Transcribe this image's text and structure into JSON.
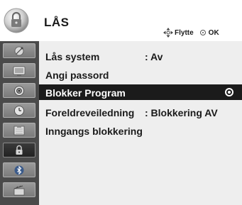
{
  "header": {
    "title": "LÅS",
    "hint_move": "Flytte",
    "hint_ok": "OK",
    "icon": "lock-icon"
  },
  "sidebar": {
    "items": [
      {
        "icon": "satellite-dish-icon",
        "active": false
      },
      {
        "icon": "tv-picture-icon",
        "active": false
      },
      {
        "icon": "speaker-audio-icon",
        "active": false
      },
      {
        "icon": "clock-icon",
        "active": false
      },
      {
        "icon": "calendar-option-icon",
        "active": false
      },
      {
        "icon": "lock-icon",
        "active": true
      },
      {
        "icon": "bluetooth-icon",
        "active": false
      },
      {
        "icon": "media-icon",
        "active": false
      }
    ]
  },
  "menu": {
    "items": [
      {
        "label": "Lås system",
        "value": ": Av"
      },
      {
        "label": "Angi passord",
        "value": ""
      },
      {
        "label": "Blokker Program",
        "value": "",
        "selected": true
      },
      {
        "label": "Foreldreveiledning",
        "value": ": Blokkering AV"
      },
      {
        "label": "Inngangs blokkering",
        "value": ""
      }
    ]
  },
  "colors": {
    "selected_row": "#1b1b1b",
    "sidebar": "#4a4a4a",
    "content": "#eeeeee"
  }
}
